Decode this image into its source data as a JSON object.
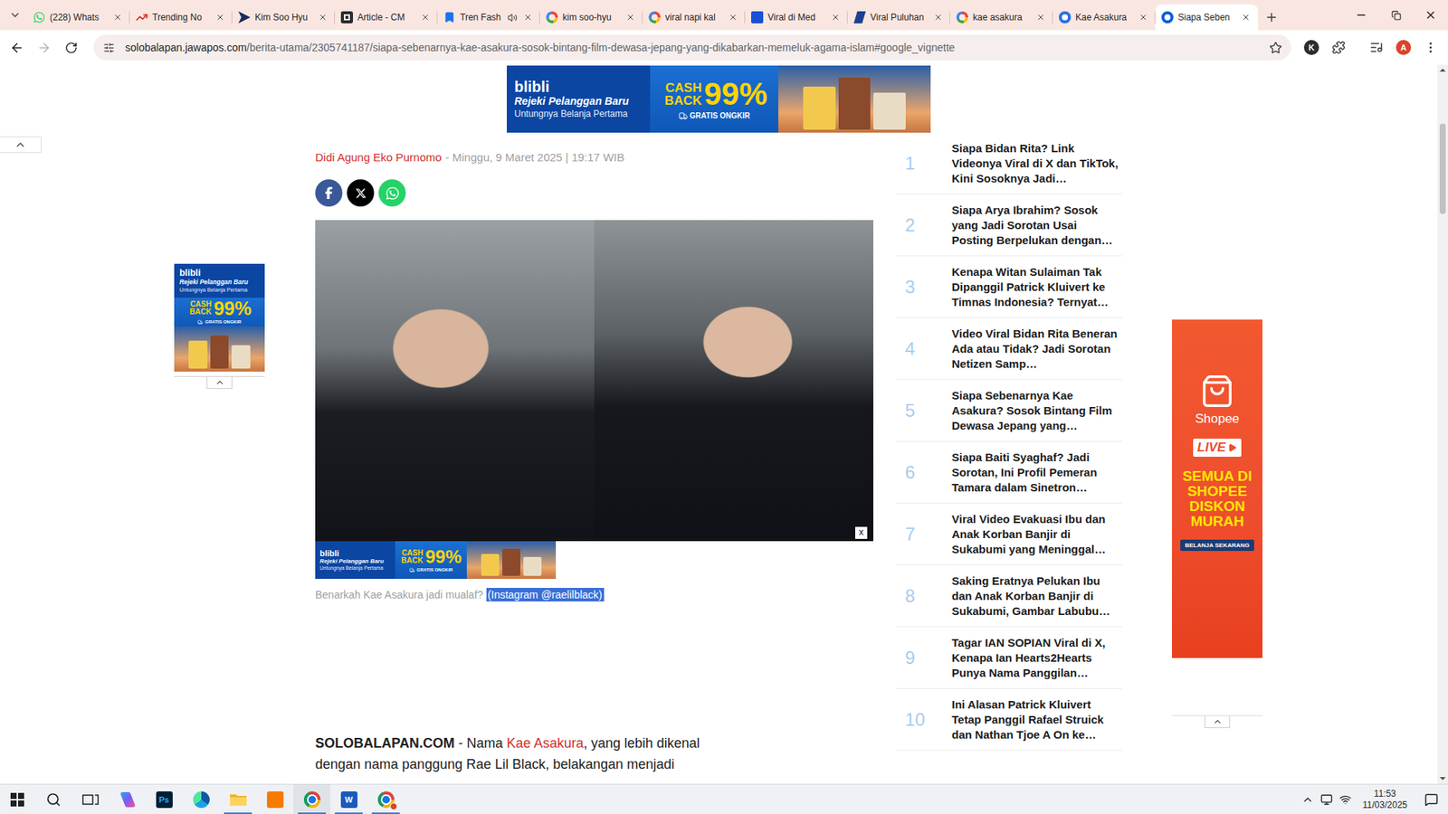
{
  "browser": {
    "tabs": [
      {
        "label": "(228) Whats",
        "kind": "whatsapp",
        "selected": false,
        "audio": false
      },
      {
        "label": "Trending No",
        "kind": "trending",
        "selected": false,
        "audio": false
      },
      {
        "label": "Kim Soo Hyu",
        "kind": "kim",
        "selected": false,
        "audio": false
      },
      {
        "label": "Article - CM",
        "kind": "cms",
        "selected": false,
        "audio": false
      },
      {
        "label": "Tren Fash",
        "kind": "tren",
        "selected": false,
        "audio": true
      },
      {
        "label": "kim soo-hyu",
        "kind": "google",
        "selected": false,
        "audio": false
      },
      {
        "label": "viral napi kal",
        "kind": "google",
        "selected": false,
        "audio": false
      },
      {
        "label": "Viral di Med",
        "kind": "jp",
        "selected": false,
        "audio": false
      },
      {
        "label": "Viral Puluhan",
        "kind": "pulu",
        "selected": false,
        "audio": false
      },
      {
        "label": "kae asakura",
        "kind": "google",
        "selected": false,
        "audio": false
      },
      {
        "label": "Kae Asakura",
        "kind": "qsearch",
        "selected": false,
        "audio": false
      },
      {
        "label": "Siapa Seben",
        "kind": "jawapos",
        "selected": true,
        "audio": false
      }
    ],
    "back_enabled": true,
    "forward_enabled": false,
    "address": {
      "domain": "solobalapan.jawapos.com",
      "path": "/berita-utama/2305741187/siapa-sebenarnya-kae-asakura-sosok-bintang-film-dewasa-jepang-yang-dikabarkan-memeluk-agama-islam#google_vignette",
      "bookmarked": false
    },
    "extension_badge": "K",
    "profile": "A",
    "scroll": {
      "level": 0.08
    }
  },
  "ads": {
    "blibli": {
      "brand": "blibli",
      "tagline": "Rejeki Pelanggan Baru",
      "subline": "Untungnya Belanja Pertama",
      "cashback": "CASH BACK",
      "percent": "99%",
      "shipping": "GRATIS ONGKIR",
      "close": "x"
    },
    "shopee": {
      "brand": "Shopee",
      "live": "LIVE",
      "headline": "SEMUA DI SHOPEE DISKON MURAH",
      "cta": "BELANJA SEKARANG"
    }
  },
  "article": {
    "author": "Didi Agung Eko Purnomo",
    "date": "- Minggu, 9 Maret 2025 | 19:17 WIB",
    "caption": {
      "text": "Benarkah Kae Asakura jadi mualaf?",
      "credit": "(Instagram @raelilblack)",
      "credit_selected": true
    },
    "body": {
      "source": "SOLOBALAPAN.COM",
      "lead": " - Nama ",
      "link": "Kae Asakura",
      "rest": ", yang lebih dikenal",
      "line2": "dengan nama panggung Rae Lil Black, belakangan menjadi"
    }
  },
  "trending": [
    {
      "rank": "1",
      "title": "Siapa Bidan Rita? Link Videonya Viral di X dan TikTok, Kini Sosoknya Jadi…"
    },
    {
      "rank": "2",
      "title": "Siapa Arya Ibrahim? Sosok yang Jadi Sorotan Usai Posting Berpelukan dengan…"
    },
    {
      "rank": "3",
      "title": "Kenapa Witan Sulaiman Tak Dipanggil Patrick Kluivert ke Timnas Indonesia? Ternyat…"
    },
    {
      "rank": "4",
      "title": "Video Viral Bidan Rita Beneran Ada atau Tidak? Jadi Sorotan Netizen Samp…"
    },
    {
      "rank": "5",
      "title": "Siapa Sebenarnya Kae Asakura? Sosok Bintang Film Dewasa Jepang yang…"
    },
    {
      "rank": "6",
      "title": "Siapa Baiti Syaghaf? Jadi Sorotan, Ini Profil Pemeran Tamara dalam Sinetron…"
    },
    {
      "rank": "7",
      "title": "Viral Video Evakuasi Ibu dan Anak Korban Banjir di Sukabumi yang Meninggal…"
    },
    {
      "rank": "8",
      "title": "Saking Eratnya Pelukan Ibu dan Anak Korban Banjir di Sukabumi, Gambar Labubu…"
    },
    {
      "rank": "9",
      "title": "Tagar IAN SOPIAN Viral di X, Kenapa Ian Hearts2Hearts Punya Nama Panggilan…"
    },
    {
      "rank": "10",
      "title": "Ini Alasan Patrick Kluivert Tetap Panggil Rafael Struick dan Nathan Tjoe A On ke…"
    }
  ],
  "taskbar": {
    "apps": [
      {
        "kind": "start",
        "label": "",
        "running": false,
        "active": false
      },
      {
        "kind": "search",
        "label": "",
        "running": false,
        "active": false
      },
      {
        "kind": "taskview",
        "label": "",
        "running": false,
        "active": false
      },
      {
        "kind": "copilot",
        "label": "",
        "running": false,
        "active": false
      },
      {
        "kind": "photoshop",
        "label": "Ps",
        "running": false,
        "active": false
      },
      {
        "kind": "edge",
        "label": "",
        "running": false,
        "active": false
      },
      {
        "kind": "explorer",
        "label": "",
        "running": true,
        "active": false
      },
      {
        "kind": "orange",
        "label": "",
        "running": false,
        "active": false
      },
      {
        "kind": "chrome",
        "label": "",
        "running": true,
        "active": true
      },
      {
        "kind": "word",
        "label": "W",
        "running": true,
        "active": false
      },
      {
        "kind": "chrome-profile",
        "label": "",
        "running": true,
        "active": false
      }
    ],
    "time": "11:53",
    "date": "11/03/2025"
  }
}
